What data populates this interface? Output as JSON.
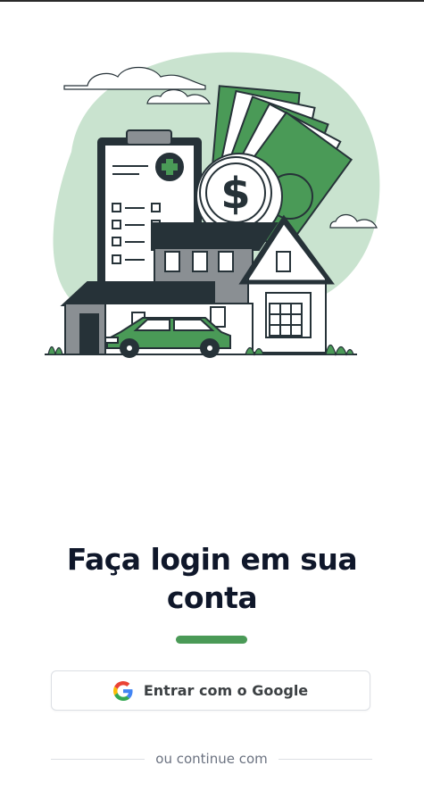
{
  "login": {
    "title_line1": "Faça login em sua",
    "title_line2": "conta",
    "google_button_label": "Entrar com o Google",
    "divider_text": "ou continue com"
  },
  "colors": {
    "accent": "#4a9a57",
    "blob": "#c9e3cf",
    "dark": "#263238"
  },
  "icons": {
    "google": "google-icon",
    "illustration": "house-money-illustration"
  }
}
